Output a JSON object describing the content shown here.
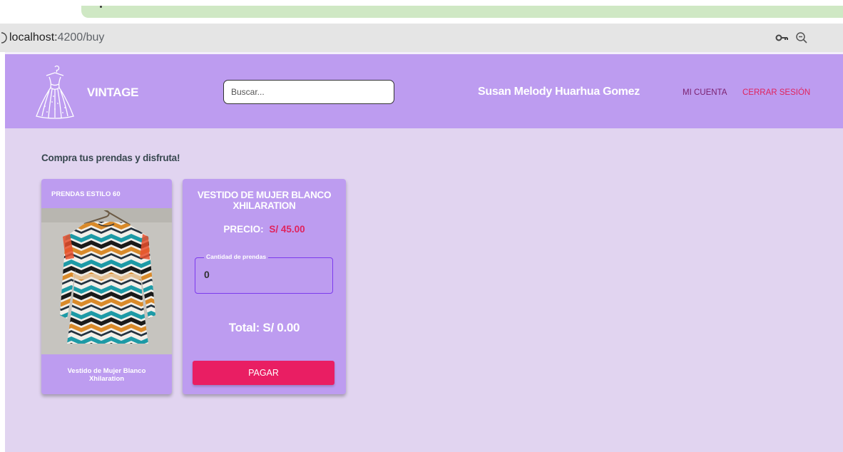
{
  "browser": {
    "url_host": "localhost:",
    "url_rest": "4200/buy"
  },
  "header": {
    "brand": "VINTAGE",
    "search_placeholder": "Buscar...",
    "user_name": "Susan Melody Huarhua Gomez",
    "account_link": "MI CUENTA",
    "logout_link": "CERRAR SESIÓN"
  },
  "main": {
    "subtitle": "Compra tus prendas y disfruta!",
    "product_card": {
      "title": "PRENDAS ESTILO 60",
      "caption": "Vestido de Mujer Blanco Xhilaration"
    },
    "purchase_card": {
      "title": "VESTIDO DE MUJER BLANCO XHILARATION",
      "price_label": "PRECIO:",
      "price_value": "S/ 45.00",
      "quantity_label": "Cantidad de prendas",
      "quantity_value": "0",
      "total": "Total: S/ 0.00",
      "pay_button": "PAGAR"
    }
  },
  "colors": {
    "header_bg": "#bd9cf0",
    "page_bg": "#e1d4f0",
    "accent": "#e91e63",
    "field_border": "#7c3aed"
  }
}
